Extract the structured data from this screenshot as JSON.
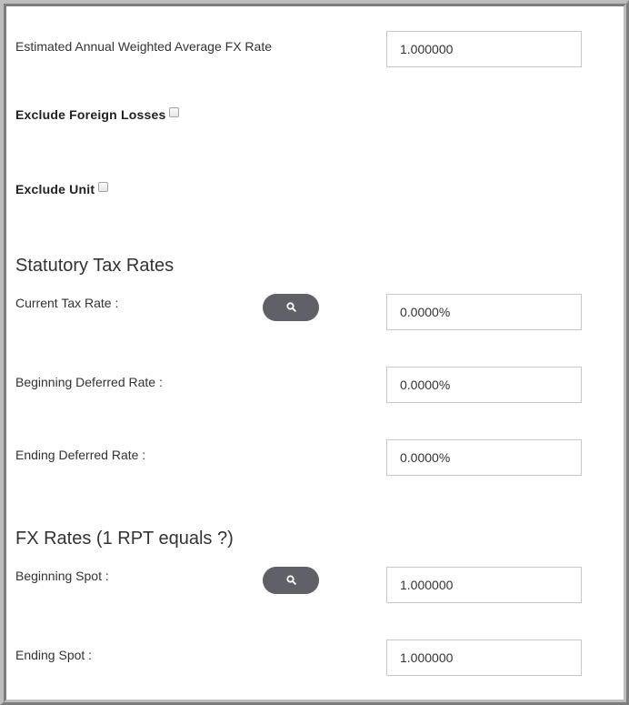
{
  "fx_weighted": {
    "label": "Estimated Annual Weighted Average FX Rate",
    "value": "1.000000"
  },
  "exclude_foreign_losses": {
    "label": "Exclude Foreign Losses",
    "checked": false
  },
  "exclude_unit": {
    "label": "Exclude Unit",
    "checked": false
  },
  "statutory": {
    "title": "Statutory Tax Rates",
    "current_tax_rate": {
      "label": "Current Tax Rate :",
      "value": "0.0000%"
    },
    "beginning_deferred_rate": {
      "label": "Beginning Deferred Rate :",
      "value": "0.0000%"
    },
    "ending_deferred_rate": {
      "label": "Ending Deferred Rate :",
      "value": "0.0000%"
    },
    "lookup_icon": "search-icon"
  },
  "fx_rates": {
    "title": "FX Rates (1 RPT equals ?)",
    "beginning_spot": {
      "label": "Beginning Spot :",
      "value": "1.000000"
    },
    "ending_spot": {
      "label": "Ending Spot :",
      "value": "1.000000"
    },
    "lookup_icon": "search-icon"
  },
  "colors": {
    "button_bg": "#5f6068",
    "field_border": "#c8c8c8",
    "text": "#333333"
  }
}
